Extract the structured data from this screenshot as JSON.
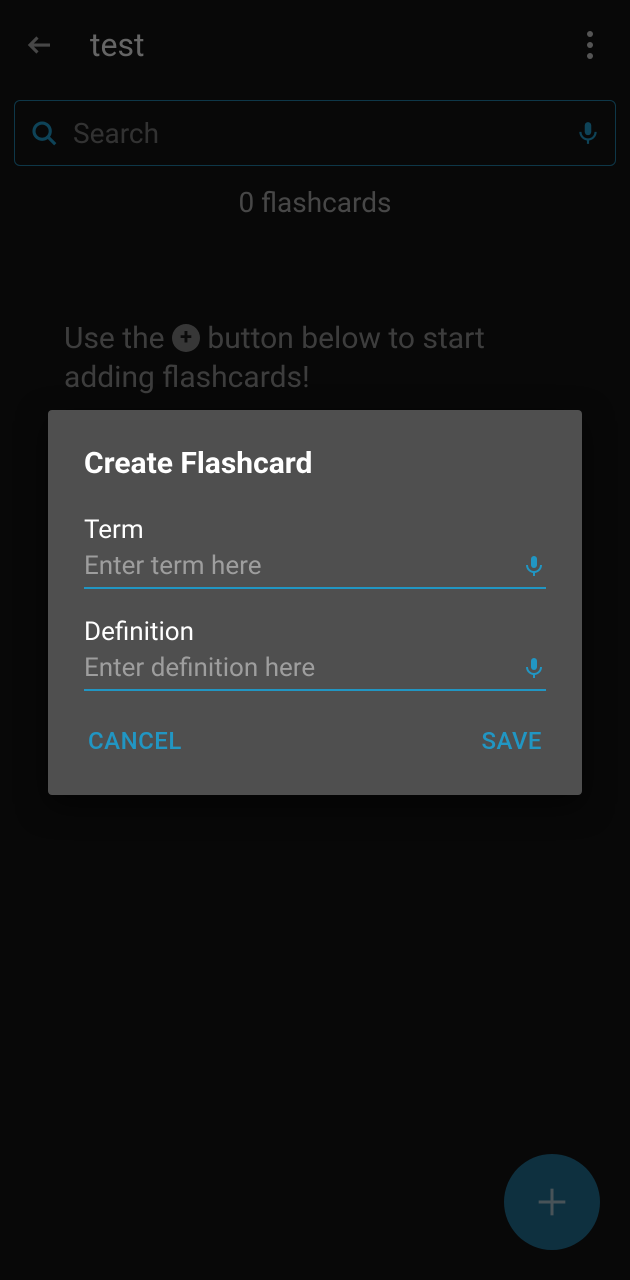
{
  "header": {
    "title": "test"
  },
  "search": {
    "placeholder": "Search"
  },
  "count_text": "0 flashcards",
  "hint": {
    "prefix": "Use the ",
    "suffix": " button below to start adding flashcards!"
  },
  "dialog": {
    "title": "Create Flashcard",
    "term_label": "Term",
    "term_placeholder": "Enter term here",
    "definition_label": "Definition",
    "definition_placeholder": "Enter definition here",
    "cancel_label": "CANCEL",
    "save_label": "SAVE"
  },
  "colors": {
    "accent": "#2196c3"
  }
}
